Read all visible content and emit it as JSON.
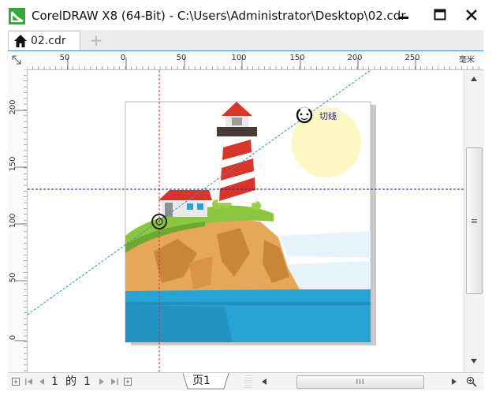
{
  "window": {
    "title": "CorelDRAW X8 (64-Bit) - C:\\Users\\Administrator\\Desktop\\02.cdr",
    "minimize_label": "minimize",
    "maximize_label": "maximize",
    "close_label": "close"
  },
  "tabs": {
    "document_tab": "02.cdr",
    "add_tab": "+"
  },
  "rulers": {
    "horizontal_labels": [
      "50",
      "0",
      "50",
      "100",
      "150",
      "200",
      "250"
    ],
    "units": "毫米",
    "vertical_labels": [
      "200",
      "150",
      "100",
      "50",
      "0"
    ],
    "corner_glyph": "⤡"
  },
  "canvas": {
    "snap_label": "切线",
    "icon_names": [
      "lighthouse-artwork",
      "snap-target-icon",
      "tangent-snap-icon"
    ]
  },
  "status_bar": {
    "page_current": "1",
    "page_of": "的",
    "page_total": "1",
    "page_tab_label": "页1",
    "hscroll_grip": "III",
    "vscroll_grip": "≡"
  },
  "colors": {
    "accent": "#3d89c8",
    "guide_vertical": "#d32f2f",
    "guide_horizontal": "#1a1aa0",
    "tangent_line": "#2a8fd8",
    "sea": "#29a3d3",
    "cliff": "#e5a85a",
    "grass": "#8cc63f",
    "sun": "#fdf7c3",
    "lighthouse_red": "#d9362b"
  }
}
